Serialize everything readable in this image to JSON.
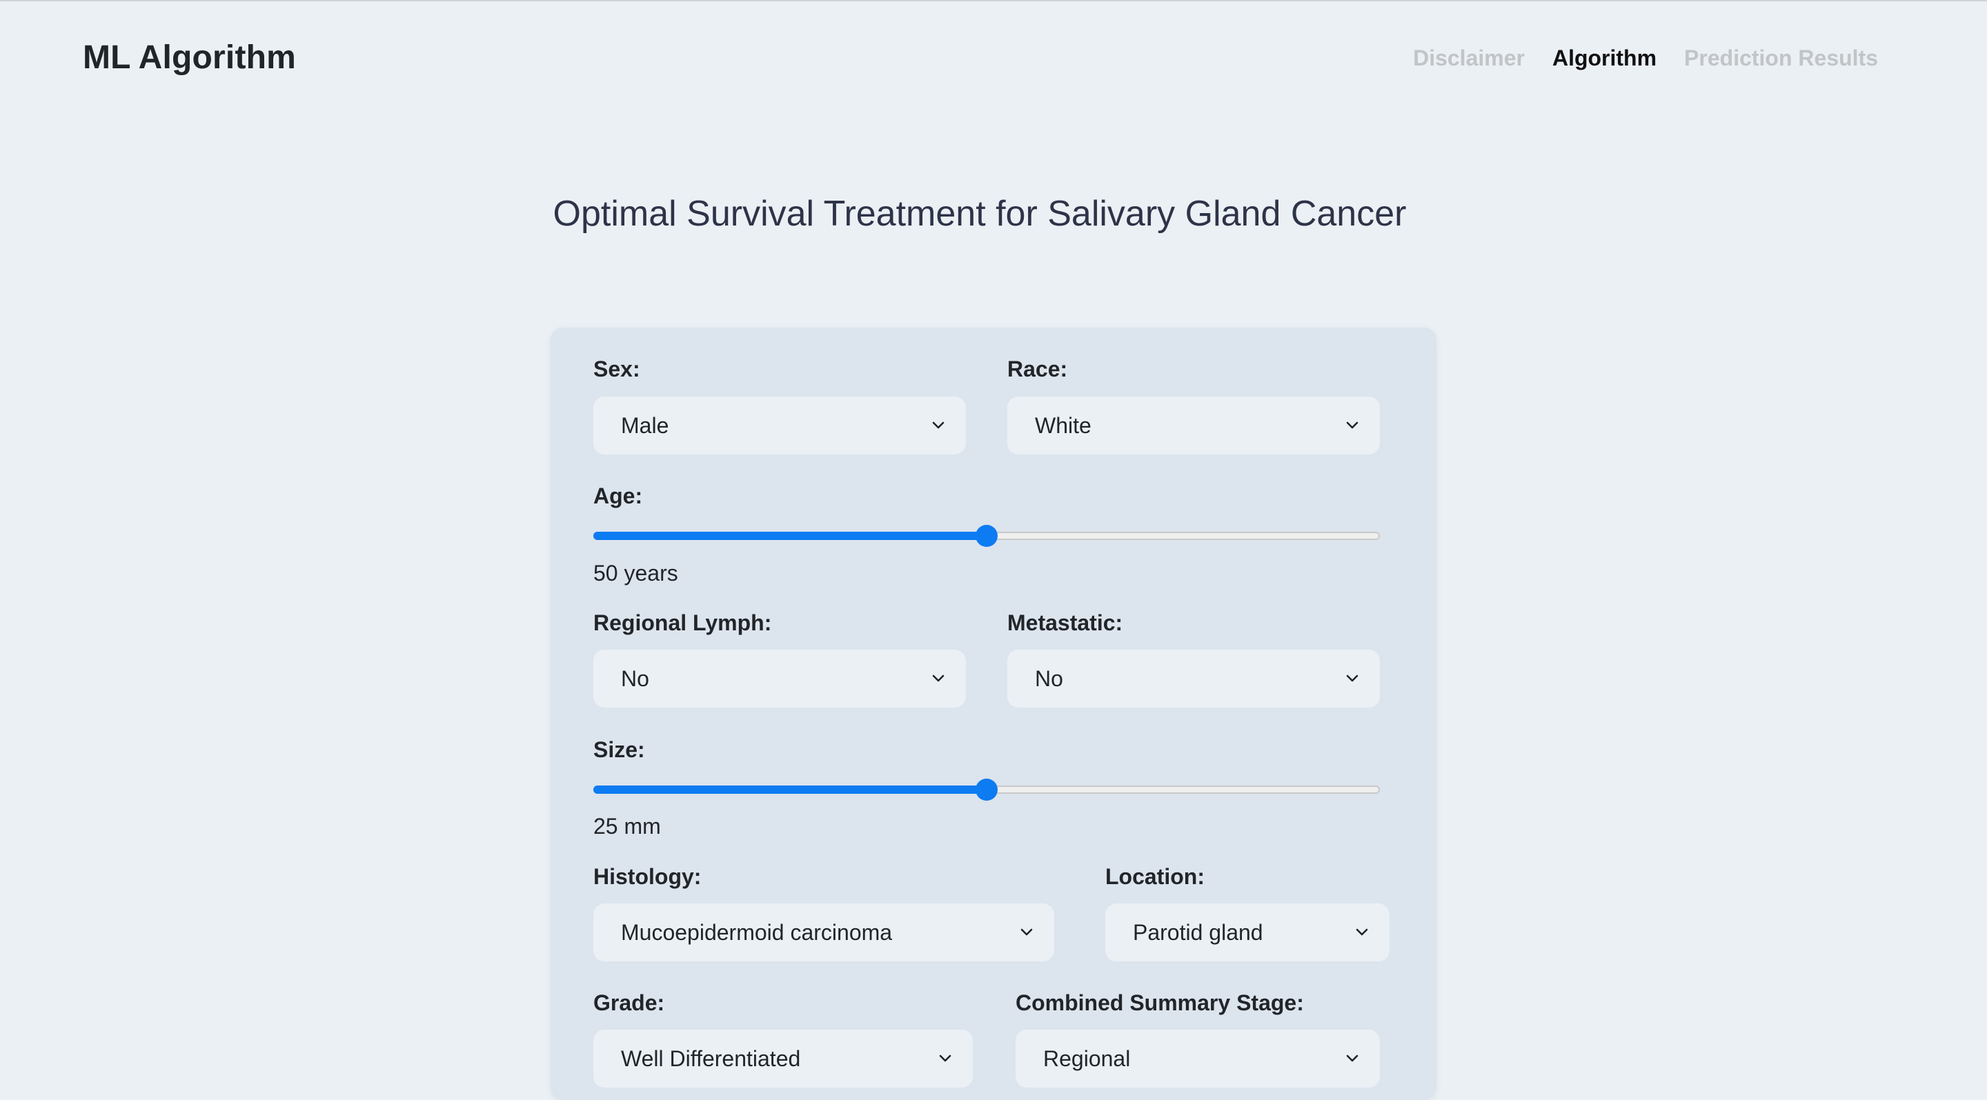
{
  "nav": {
    "brand": "ML Algorithm",
    "links": [
      "Disclaimer",
      "Algorithm",
      "Prediction Results"
    ],
    "active_index": 1
  },
  "page": {
    "title": "Optimal Survival Treatment for Salivary Gland Cancer"
  },
  "form": {
    "sex": {
      "label": "Sex:",
      "value": "Male"
    },
    "race": {
      "label": "Race:",
      "value": "White"
    },
    "age": {
      "label": "Age:",
      "display": "50 years",
      "fraction": 0.5
    },
    "regional_lymph": {
      "label": "Regional Lymph:",
      "value": "No"
    },
    "metastatic": {
      "label": "Metastatic:",
      "value": "No"
    },
    "size": {
      "label": "Size:",
      "display": "25 mm",
      "fraction": 0.5
    },
    "histology": {
      "label": "Histology:",
      "value": "Mucoepidermoid carcinoma"
    },
    "location": {
      "label": "Location:",
      "value": "Parotid gland"
    },
    "grade": {
      "label": "Grade:",
      "value": "Well Differentiated"
    },
    "stage": {
      "label": "Combined Summary Stage:",
      "value": "Regional"
    }
  },
  "colors": {
    "background": "#ebf0f5",
    "card": "#dce4ee",
    "accent": "#0d7bf2",
    "nav_inactive": "#c2c4c6"
  },
  "icons": {
    "select_indicator": "chevron-down-icon"
  }
}
